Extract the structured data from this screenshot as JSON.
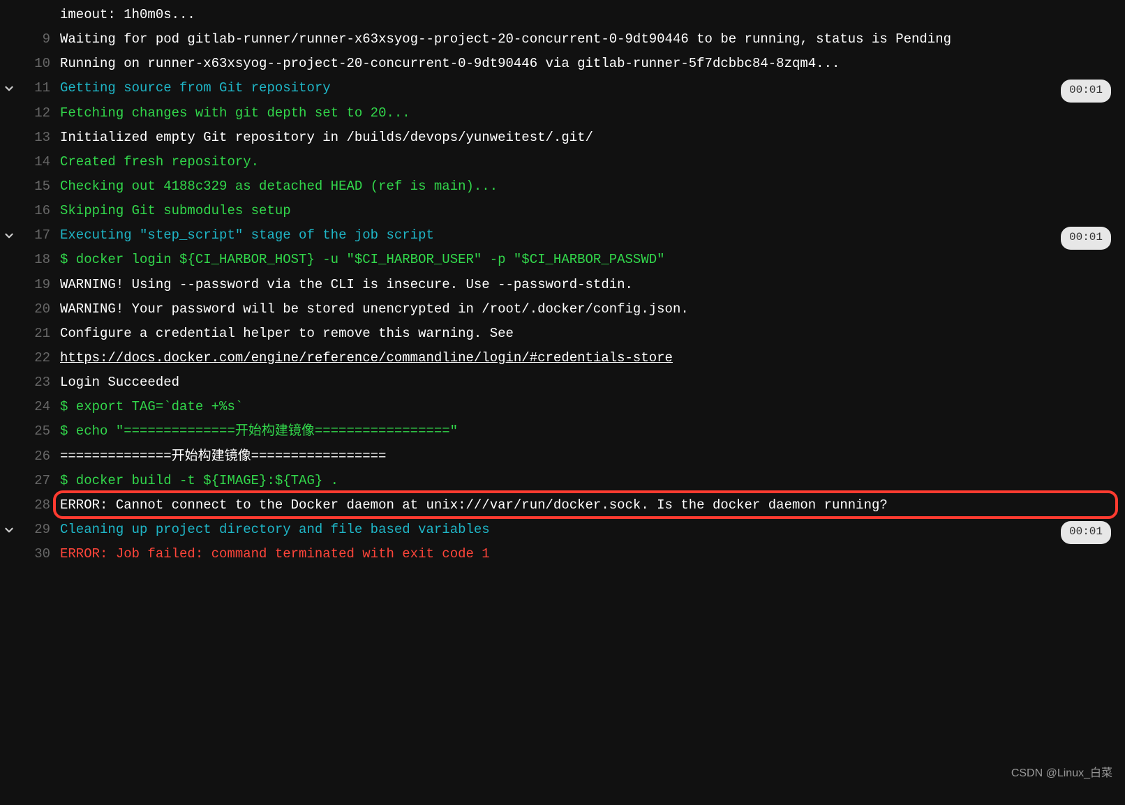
{
  "colors": {
    "bg": "#111111",
    "white": "#ffffff",
    "cyan": "#1fb6c7",
    "green": "#32d74b",
    "red": "#ff453a",
    "lineno": "#666666",
    "pillBg": "#e7e7e7",
    "pillFg": "#333333",
    "highlight": "#ff3b30"
  },
  "watermark": "CSDN @Linux_白菜",
  "highlight_line": 28,
  "lines": [
    {
      "n": "",
      "chevron": false,
      "pill": "",
      "segments": [
        {
          "cls": "c-white",
          "text": "imeout: 1h0m0s..."
        }
      ]
    },
    {
      "n": "9",
      "chevron": false,
      "pill": "",
      "segments": [
        {
          "cls": "c-white",
          "text": "Waiting for pod gitlab-runner/runner-x63xsyog--project-20-concurrent-0-9dt90446 to be running, status is Pending"
        }
      ]
    },
    {
      "n": "10",
      "chevron": false,
      "pill": "",
      "segments": [
        {
          "cls": "c-white",
          "text": "Running on runner-x63xsyog--project-20-concurrent-0-9dt90446 via gitlab-runner-5f7dcbbc84-8zqm4..."
        }
      ]
    },
    {
      "n": "11",
      "chevron": true,
      "pill": "00:01",
      "segments": [
        {
          "cls": "c-cyan",
          "text": "Getting source from Git repository"
        }
      ]
    },
    {
      "n": "12",
      "chevron": false,
      "pill": "",
      "segments": [
        {
          "cls": "c-green",
          "text": "Fetching changes with git depth set to 20..."
        }
      ]
    },
    {
      "n": "13",
      "chevron": false,
      "pill": "",
      "segments": [
        {
          "cls": "c-white",
          "text": "Initialized empty Git repository in /builds/devops/yunweitest/.git/"
        }
      ]
    },
    {
      "n": "14",
      "chevron": false,
      "pill": "",
      "segments": [
        {
          "cls": "c-green",
          "text": "Created fresh repository."
        }
      ]
    },
    {
      "n": "15",
      "chevron": false,
      "pill": "",
      "segments": [
        {
          "cls": "c-green",
          "text": "Checking out 4188c329 as detached HEAD (ref is main)..."
        }
      ]
    },
    {
      "n": "16",
      "chevron": false,
      "pill": "",
      "segments": [
        {
          "cls": "c-green",
          "text": "Skipping Git submodules setup"
        }
      ]
    },
    {
      "n": "17",
      "chevron": true,
      "pill": "00:01",
      "segments": [
        {
          "cls": "c-cyan",
          "text": "Executing \"step_script\" stage of the job script"
        }
      ]
    },
    {
      "n": "18",
      "chevron": false,
      "pill": "",
      "segments": [
        {
          "cls": "c-green",
          "text": "$ docker login ${CI_HARBOR_HOST} -u \"$CI_HARBOR_USER\" -p \"$CI_HARBOR_PASSWD\""
        }
      ]
    },
    {
      "n": "19",
      "chevron": false,
      "pill": "",
      "segments": [
        {
          "cls": "c-white",
          "text": "WARNING! Using --password via the CLI is insecure. Use --password-stdin."
        }
      ]
    },
    {
      "n": "20",
      "chevron": false,
      "pill": "",
      "segments": [
        {
          "cls": "c-white",
          "text": "WARNING! Your password will be stored unencrypted in /root/.docker/config.json."
        }
      ]
    },
    {
      "n": "21",
      "chevron": false,
      "pill": "",
      "segments": [
        {
          "cls": "c-white",
          "text": "Configure a credential helper to remove this warning. See"
        }
      ]
    },
    {
      "n": "22",
      "chevron": false,
      "pill": "",
      "segments": [
        {
          "cls": "c-link",
          "text": "https://docs.docker.com/engine/reference/commandline/login/#credentials-store",
          "link": true
        }
      ]
    },
    {
      "n": "23",
      "chevron": false,
      "pill": "",
      "segments": [
        {
          "cls": "c-white",
          "text": "Login Succeeded"
        }
      ]
    },
    {
      "n": "24",
      "chevron": false,
      "pill": "",
      "segments": [
        {
          "cls": "c-green",
          "text": "$ export TAG=`date +%s`"
        }
      ]
    },
    {
      "n": "25",
      "chevron": false,
      "pill": "",
      "segments": [
        {
          "cls": "c-green",
          "text": "$ echo \"==============开始构建镜像=================\""
        }
      ]
    },
    {
      "n": "26",
      "chevron": false,
      "pill": "",
      "segments": [
        {
          "cls": "c-white",
          "text": "==============开始构建镜像================="
        }
      ]
    },
    {
      "n": "27",
      "chevron": false,
      "pill": "",
      "segments": [
        {
          "cls": "c-green",
          "text": "$ docker build -t ${IMAGE}:${TAG} ."
        }
      ]
    },
    {
      "n": "28",
      "chevron": false,
      "pill": "",
      "segments": [
        {
          "cls": "c-white",
          "text": "ERROR: Cannot connect to the Docker daemon at unix:///var/run/docker.sock. Is the docker daemon running?"
        }
      ]
    },
    {
      "n": "29",
      "chevron": true,
      "pill": "00:01",
      "segments": [
        {
          "cls": "c-cyan",
          "text": "Cleaning up project directory and file based variables"
        }
      ]
    },
    {
      "n": "30",
      "chevron": false,
      "pill": "",
      "segments": [
        {
          "cls": "c-red",
          "text": "ERROR: Job failed: command terminated with exit code 1"
        }
      ]
    }
  ]
}
